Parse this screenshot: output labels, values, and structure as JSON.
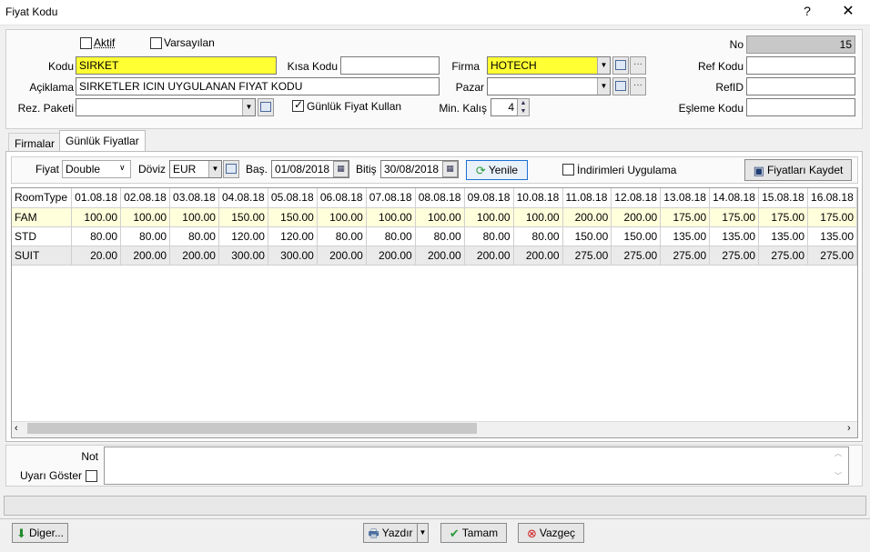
{
  "window": {
    "title": "Fiyat Kodu",
    "help": "?",
    "close": "✕"
  },
  "form": {
    "aktif_label": "Aktif",
    "aktif_checked": false,
    "varsayilan_label": "Varsayılan",
    "varsayilan_checked": false,
    "kodu_label": "Kodu",
    "kodu_value": "SIRKET",
    "kisa_kodu_label": "Kısa Kodu",
    "kisa_kodu_value": "",
    "firma_label": "Firma",
    "firma_value": "HOTECH",
    "no_label": "No",
    "no_value": "15",
    "ref_kodu_label": "Ref Kodu",
    "ref_kodu_value": "",
    "aciklama_label": "Açiklama",
    "aciklama_value": "SIRKETLER ICIN UYGULANAN FIYAT KODU",
    "pazar_label": "Pazar",
    "pazar_value": "",
    "refid_label": "RefID",
    "refid_value": "",
    "rez_paketi_label": "Rez. Paketi",
    "rez_paketi_value": "",
    "gunluk_fiyat_label": "Günlük Fiyat Kullan",
    "gunluk_fiyat_checked": true,
    "min_kalis_label": "Min. Kalış",
    "min_kalis_value": "4",
    "esleme_kodu_label": "Eşleme Kodu",
    "esleme_kodu_value": ""
  },
  "tabs": [
    {
      "label": "Firmalar",
      "active": false
    },
    {
      "label": "Günlük Fiyatlar",
      "active": true
    }
  ],
  "toolbar": {
    "fiyat_label": "Fiyat",
    "fiyat_value": "Double",
    "doviz_label": "Döviz",
    "doviz_value": "EUR",
    "bas_label": "Baş.",
    "bas_value": "01/08/2018",
    "bitis_label": "Bitiş",
    "bitis_value": "30/08/2018",
    "yenile_label": "Yenile",
    "indirim_label": "İndirimleri Uygulama",
    "indirim_checked": false,
    "kaydet_label": "Fiyatları Kaydet"
  },
  "grid": {
    "headers": [
      "RoomType",
      "01.08.18",
      "02.08.18",
      "03.08.18",
      "04.08.18",
      "05.08.18",
      "06.08.18",
      "07.08.18",
      "08.08.18",
      "09.08.18",
      "10.08.18",
      "11.08.18",
      "12.08.18",
      "13.08.18",
      "14.08.18",
      "15.08.18",
      "16.08.18"
    ],
    "rows": [
      [
        "FAM",
        "100.00",
        "100.00",
        "100.00",
        "150.00",
        "150.00",
        "100.00",
        "100.00",
        "100.00",
        "100.00",
        "100.00",
        "200.00",
        "200.00",
        "175.00",
        "175.00",
        "175.00",
        "175.00"
      ],
      [
        "STD",
        "80.00",
        "80.00",
        "80.00",
        "120.00",
        "120.00",
        "80.00",
        "80.00",
        "80.00",
        "80.00",
        "80.00",
        "150.00",
        "150.00",
        "135.00",
        "135.00",
        "135.00",
        "135.00"
      ],
      [
        "SUIT",
        "20.00",
        "200.00",
        "200.00",
        "300.00",
        "300.00",
        "200.00",
        "200.00",
        "200.00",
        "200.00",
        "200.00",
        "275.00",
        "275.00",
        "275.00",
        "275.00",
        "275.00",
        "275.00"
      ]
    ]
  },
  "note": {
    "not_label": "Not",
    "not_value": "",
    "uyari_label": "Uyarı Göster",
    "uyari_checked": false
  },
  "footer": {
    "diger_label": "Diger...",
    "yazdir_label": "Yazdır",
    "tamam_label": "Tamam",
    "vazgec_label": "Vazgeç"
  },
  "icons": {
    "yenile": "refresh-icon",
    "kaydet": "floppy-icon",
    "diger": "arrow-down-icon",
    "yazdir": "print-icon",
    "tamam": "check-icon",
    "vazgec": "cancel-icon"
  },
  "colors": {
    "required_field": "#ffff33",
    "selected_row": "#ffffdc",
    "accent_border": "#1a6fd1"
  }
}
